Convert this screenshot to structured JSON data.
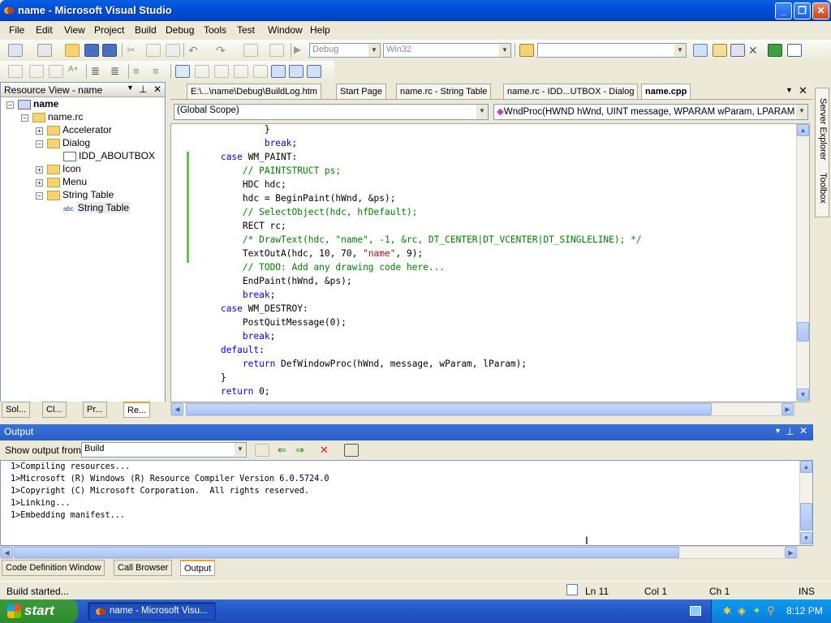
{
  "window": {
    "title": "name - Microsoft Visual Studio"
  },
  "menu": [
    "File",
    "Edit",
    "View",
    "Project",
    "Build",
    "Debug",
    "Tools",
    "Test",
    "Window",
    "Help"
  ],
  "toolbar": {
    "config": "Debug",
    "platform": "Win32",
    "find_value": ""
  },
  "resource_view": {
    "title": "Resource View - name",
    "tree": {
      "root": "name",
      "rc": "name.rc",
      "accelerator": "Accelerator",
      "dialog": "Dialog",
      "about": "IDD_ABOUTBOX",
      "icon": "Icon",
      "menu": "Menu",
      "string_table": "String Table",
      "string_table_item": "String Table"
    },
    "bottom_tabs": [
      "Sol...",
      "Cl...",
      "Pr...",
      "Re..."
    ]
  },
  "editor": {
    "tabs": [
      "E:\\...\\name\\Debug\\BuildLog.htm",
      "Start Page",
      "name.rc - String Table",
      "name.rc - IDD...UTBOX - Dialog",
      "name.cpp"
    ],
    "scope": "(Global Scope)",
    "function": "WndProc(HWND hWnd, UINT message, WPARAM wParam, LPARAM lPara"
  },
  "right_tabs": {
    "server_explorer": "Server Explorer",
    "toolbox": "Toolbox"
  },
  "output": {
    "title": "Output",
    "show_label": "Show output from:",
    "source": "Build",
    "lines": [
      "1>Compiling resources...",
      "1>Microsoft (R) Windows (R) Resource Compiler Version 6.0.5724.0",
      "1>Copyright (C) Microsoft Corporation.  All rights reserved.",
      "1>Linking...",
      "1>Embedding manifest..."
    ],
    "bottom_tabs": [
      "Code Definition Window",
      "Call Browser",
      "Output"
    ]
  },
  "status": {
    "text": "Build started...",
    "ln": "Ln 11",
    "col": "Col 1",
    "ch": "Ch 1",
    "mode": "INS"
  },
  "taskbar": {
    "start": "start",
    "task": "name - Microsoft Visu...",
    "clock": "8:12 PM"
  }
}
